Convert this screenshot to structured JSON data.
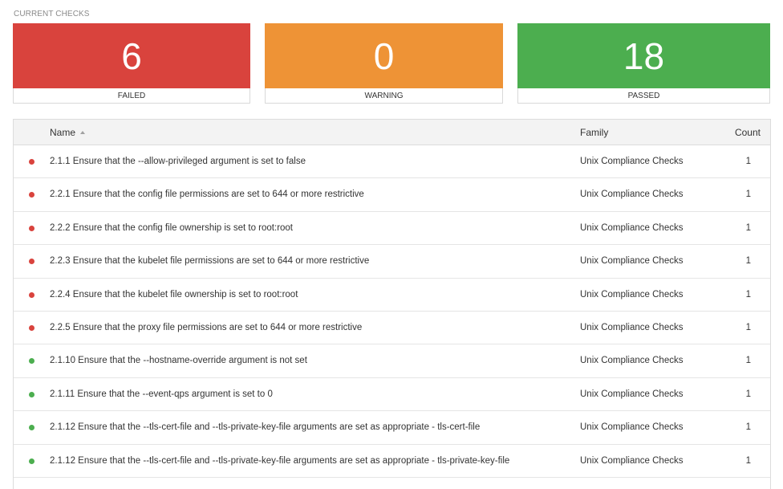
{
  "section_label": "CURRENT CHECKS",
  "summary": {
    "failed": {
      "count": "6",
      "label": "FAILED",
      "color": "#d9433d"
    },
    "warning": {
      "count": "0",
      "label": "WARNING",
      "color": "#ee9336"
    },
    "passed": {
      "count": "18",
      "label": "PASSED",
      "color": "#4cae4f"
    }
  },
  "table": {
    "headers": {
      "name": "Name",
      "family": "Family",
      "count": "Count"
    },
    "sort_icon": "sort-ascending-icon",
    "rows": [
      {
        "status": "failed",
        "status_color": "#d9433d",
        "name": "2.1.1 Ensure that the --allow-privileged argument is set to false",
        "family": "Unix Compliance Checks",
        "count": "1"
      },
      {
        "status": "failed",
        "status_color": "#d9433d",
        "name": "2.2.1 Ensure that the config file permissions are set to 644 or more restrictive",
        "family": "Unix Compliance Checks",
        "count": "1"
      },
      {
        "status": "failed",
        "status_color": "#d9433d",
        "name": "2.2.2 Ensure that the config file ownership is set to root:root",
        "family": "Unix Compliance Checks",
        "count": "1"
      },
      {
        "status": "failed",
        "status_color": "#d9433d",
        "name": "2.2.3 Ensure that the kubelet file permissions are set to 644 or more restrictive",
        "family": "Unix Compliance Checks",
        "count": "1"
      },
      {
        "status": "failed",
        "status_color": "#d9433d",
        "name": "2.2.4 Ensure that the kubelet file ownership is set to root:root",
        "family": "Unix Compliance Checks",
        "count": "1"
      },
      {
        "status": "failed",
        "status_color": "#d9433d",
        "name": "2.2.5 Ensure that the proxy file permissions are set to 644 or more restrictive",
        "family": "Unix Compliance Checks",
        "count": "1"
      },
      {
        "status": "passed",
        "status_color": "#4cae4f",
        "name": "2.1.10 Ensure that the --hostname-override argument is not set",
        "family": "Unix Compliance Checks",
        "count": "1"
      },
      {
        "status": "passed",
        "status_color": "#4cae4f",
        "name": "2.1.11 Ensure that the --event-qps argument is set to 0",
        "family": "Unix Compliance Checks",
        "count": "1"
      },
      {
        "status": "passed",
        "status_color": "#4cae4f",
        "name": "2.1.12 Ensure that the --tls-cert-file and --tls-private-key-file arguments are set as appropriate - tls-cert-file",
        "family": "Unix Compliance Checks",
        "count": "1"
      },
      {
        "status": "passed",
        "status_color": "#4cae4f",
        "name": "2.1.12 Ensure that the --tls-cert-file and --tls-private-key-file arguments are set as appropriate - tls-private-key-file",
        "family": "Unix Compliance Checks",
        "count": "1"
      }
    ]
  }
}
